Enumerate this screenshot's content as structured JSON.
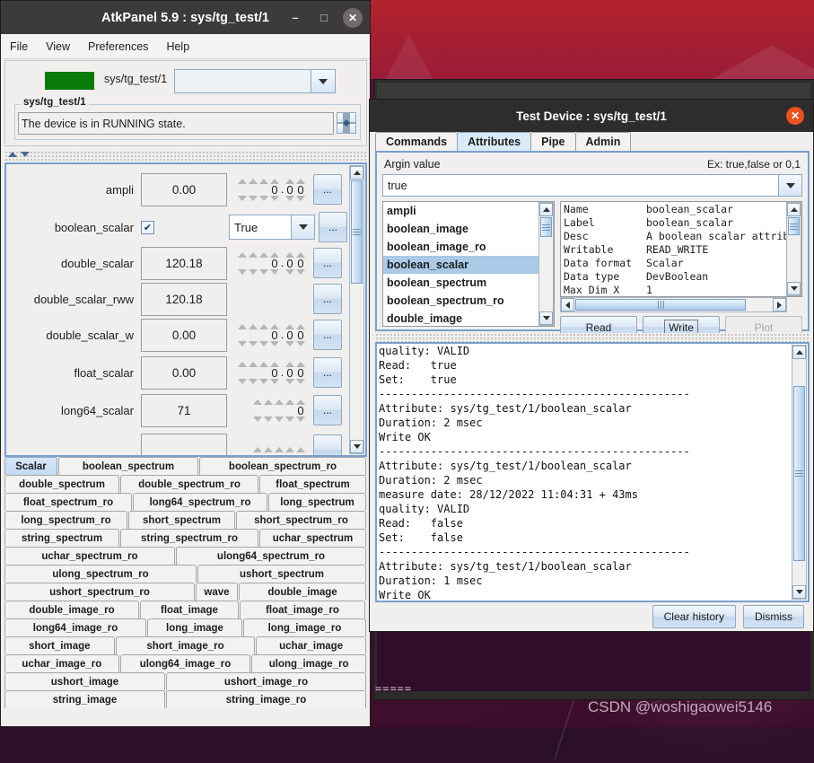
{
  "desktop": {
    "watermark": "CSDN @woshigaowei5146",
    "back_window_text": "=====",
    "wallpaper_top_color": "#a31f33",
    "wallpaper_body_color": "#4a1134"
  },
  "atkpanel": {
    "title": "AtkPanel 5.9 : sys/tg_test/1",
    "window_buttons": {
      "minimize": "–",
      "maximize": "□",
      "close": "✕"
    },
    "menu": [
      "File",
      "View",
      "Preferences",
      "Help"
    ],
    "device": {
      "led_color": "#0a7a08",
      "name": "sys/tg_test/1",
      "combo_value": ""
    },
    "status_group": {
      "label": "sys/tg_test/1",
      "text": "The device is in RUNNING state."
    },
    "attributes": [
      {
        "label": "ampli",
        "kind": "spin",
        "value": "0.00",
        "digits_int": 4,
        "digits_frac": 2,
        "spin_value": "0.00",
        "button": "..."
      },
      {
        "label": "boolean_scalar",
        "kind": "bool",
        "checked": true,
        "combo_value": "True",
        "button": "..."
      },
      {
        "label": "double_scalar",
        "kind": "spin",
        "value": "120.18",
        "digits_int": 4,
        "digits_frac": 2,
        "spin_value": "0.00",
        "button": "..."
      },
      {
        "label": "double_scalar_rww",
        "kind": "plain",
        "value": "120.18",
        "button": "..."
      },
      {
        "label": "double_scalar_w",
        "kind": "spin",
        "value": "0.00",
        "digits_int": 4,
        "digits_frac": 2,
        "spin_value": "0.00",
        "button": "..."
      },
      {
        "label": "float_scalar",
        "kind": "spin",
        "value": "0.00",
        "digits_int": 4,
        "digits_frac": 2,
        "spin_value": "0.00",
        "button": "..."
      },
      {
        "label": "long64_scalar",
        "kind": "int",
        "value": "71",
        "digits_int": 5,
        "spin_value": "0",
        "button": "..."
      }
    ],
    "tabs": [
      [
        "Scalar",
        "boolean_spectrum",
        "boolean_spectrum_ro"
      ],
      [
        "double_spectrum",
        "double_spectrum_ro",
        "float_spectrum"
      ],
      [
        "float_spectrum_ro",
        "long64_spectrum_ro",
        "long_spectrum"
      ],
      [
        "long_spectrum_ro",
        "short_spectrum",
        "short_spectrum_ro"
      ],
      [
        "string_spectrum",
        "string_spectrum_ro",
        "uchar_spectrum"
      ],
      [
        "uchar_spectrum_ro",
        "ulong64_spectrum_ro"
      ],
      [
        "ulong_spectrum_ro",
        "ushort_spectrum"
      ],
      [
        "ushort_spectrum_ro",
        "wave",
        "double_image"
      ],
      [
        "double_image_ro",
        "float_image",
        "float_image_ro"
      ],
      [
        "long64_image_ro",
        "long_image",
        "long_image_ro"
      ],
      [
        "short_image",
        "short_image_ro",
        "uchar_image"
      ],
      [
        "uchar_image_ro",
        "ulong64_image_ro",
        "ulong_image_ro"
      ],
      [
        "ushort_image",
        "ushort_image_ro"
      ],
      [
        "string_image",
        "string_image_ro"
      ]
    ],
    "selected_tab": "Scalar"
  },
  "dialog": {
    "title": "Test Device : sys/tg_test/1",
    "close_label": "✕",
    "tabs": [
      "Commands",
      "Attributes",
      "Pipe",
      "Admin"
    ],
    "selected_tab": "Attributes",
    "argin": {
      "label": "Argin value",
      "hint": "Ex: true,false or 0,1",
      "value": "true"
    },
    "attribute_list": [
      "ampli",
      "boolean_image",
      "boolean_image_ro",
      "boolean_scalar",
      "boolean_spectrum",
      "boolean_spectrum_ro",
      "double_image"
    ],
    "selected_attribute": "boolean_scalar",
    "properties": [
      {
        "key": "Name",
        "value": "boolean_scalar"
      },
      {
        "key": "Label",
        "value": "boolean_scalar"
      },
      {
        "key": "Desc",
        "value": "A boolean scalar attrib"
      },
      {
        "key": "Writable",
        "value": "READ_WRITE"
      },
      {
        "key": "Data format",
        "value": "Scalar"
      },
      {
        "key": "Data type",
        "value": "DevBoolean"
      },
      {
        "key": "Max Dim X",
        "value": "1"
      }
    ],
    "action_buttons": [
      {
        "label": "Read",
        "state": "normal"
      },
      {
        "label": "Write",
        "state": "focused"
      },
      {
        "label": "Plot",
        "state": "disabled"
      }
    ],
    "log": "quality: VALID\nRead:   true\nSet:    true\n------------------------------------------------\nAttribute: sys/tg_test/1/boolean_scalar\nDuration: 2 msec\nWrite OK\n------------------------------------------------\nAttribute: sys/tg_test/1/boolean_scalar\nDuration: 2 msec\nmeasure date: 28/12/2022 11:04:31 + 43ms\nquality: VALID\nRead:   false\nSet:    false\n------------------------------------------------\nAttribute: sys/tg_test/1/boolean_scalar\nDuration: 1 msec\nWrite OK",
    "bottom_buttons": [
      "Clear history",
      "Dismiss"
    ]
  }
}
